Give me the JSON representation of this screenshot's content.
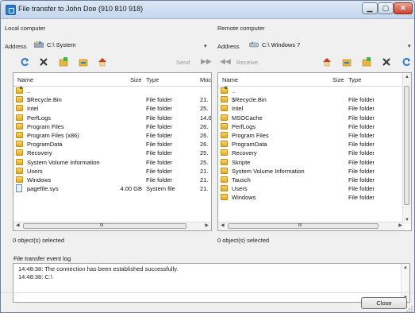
{
  "window": {
    "title": "File transfer to John Doe (910 810 918)"
  },
  "local": {
    "panel_label": "Local computer",
    "address_label": "Address",
    "address_value": "C:\\ System",
    "send_label": "Send",
    "columns": {
      "name": "Name",
      "size": "Size",
      "type": "Type",
      "modified": "Moc"
    },
    "rows": [
      {
        "name": "..",
        "size": "",
        "type": "",
        "modified": "",
        "icon": "up-folder"
      },
      {
        "name": "$Recycle.Bin",
        "size": "",
        "type": "File folder",
        "modified": "21.",
        "icon": "folder"
      },
      {
        "name": "Intel",
        "size": "",
        "type": "File folder",
        "modified": "25.",
        "icon": "folder"
      },
      {
        "name": "PerfLogs",
        "size": "",
        "type": "File folder",
        "modified": "14.0",
        "icon": "folder"
      },
      {
        "name": "Program Files",
        "size": "",
        "type": "File folder",
        "modified": "26.",
        "icon": "folder"
      },
      {
        "name": "Program Files (x86)",
        "size": "",
        "type": "File folder",
        "modified": "26.",
        "icon": "folder"
      },
      {
        "name": "ProgramData",
        "size": "",
        "type": "File folder",
        "modified": "26.",
        "icon": "folder"
      },
      {
        "name": "Recovery",
        "size": "",
        "type": "File folder",
        "modified": "25.",
        "icon": "folder"
      },
      {
        "name": "System Volume Information",
        "size": "",
        "type": "File folder",
        "modified": "25.",
        "icon": "folder"
      },
      {
        "name": "Users",
        "size": "",
        "type": "File folder",
        "modified": "21.",
        "icon": "folder"
      },
      {
        "name": "Windows",
        "size": "",
        "type": "File folder",
        "modified": "21.",
        "icon": "folder"
      },
      {
        "name": "pagefile.sys",
        "size": "4.00 GB",
        "type": "System file",
        "modified": "21.",
        "icon": "system-file"
      }
    ],
    "status": "0 object(s) selected"
  },
  "remote": {
    "panel_label": "Remote computer",
    "address_label": "Address",
    "address_value": "C:\\ Windows 7",
    "receive_label": "Receive",
    "columns": {
      "name": "Name",
      "size": "Size",
      "type": "Type"
    },
    "rows": [
      {
        "name": "..",
        "size": "",
        "type": "",
        "icon": "up-folder"
      },
      {
        "name": "$Recycle.Bin",
        "size": "",
        "type": "File folder",
        "icon": "folder"
      },
      {
        "name": "Intel",
        "size": "",
        "type": "File folder",
        "icon": "folder"
      },
      {
        "name": "MSOCache",
        "size": "",
        "type": "File folder",
        "icon": "folder"
      },
      {
        "name": "PerfLogs",
        "size": "",
        "type": "File folder",
        "icon": "folder"
      },
      {
        "name": "Program Files",
        "size": "",
        "type": "File folder",
        "icon": "folder"
      },
      {
        "name": "ProgramData",
        "size": "",
        "type": "File folder",
        "icon": "folder"
      },
      {
        "name": "Recovery",
        "size": "",
        "type": "File folder",
        "icon": "folder"
      },
      {
        "name": "Skripte",
        "size": "",
        "type": "File folder",
        "icon": "folder"
      },
      {
        "name": "System Volume Information",
        "size": "",
        "type": "File folder",
        "icon": "folder"
      },
      {
        "name": "Tausch",
        "size": "",
        "type": "File folder",
        "icon": "folder"
      },
      {
        "name": "Users",
        "size": "",
        "type": "File folder",
        "icon": "folder"
      },
      {
        "name": "Windows",
        "size": "",
        "type": "File folder",
        "icon": "folder"
      }
    ],
    "status": "0 object(s) selected"
  },
  "scrollbar": {
    "thumb_grip": "III"
  },
  "log": {
    "label": "File transfer event log",
    "lines": [
      "14:48:38: The connection has been established successfully.",
      "14:48:38: C:\\"
    ]
  },
  "buttons": {
    "close": "Close"
  },
  "colors": {
    "folder": "#e9b83a",
    "refresh": "#2a7bd0",
    "home": "#c0392b"
  }
}
